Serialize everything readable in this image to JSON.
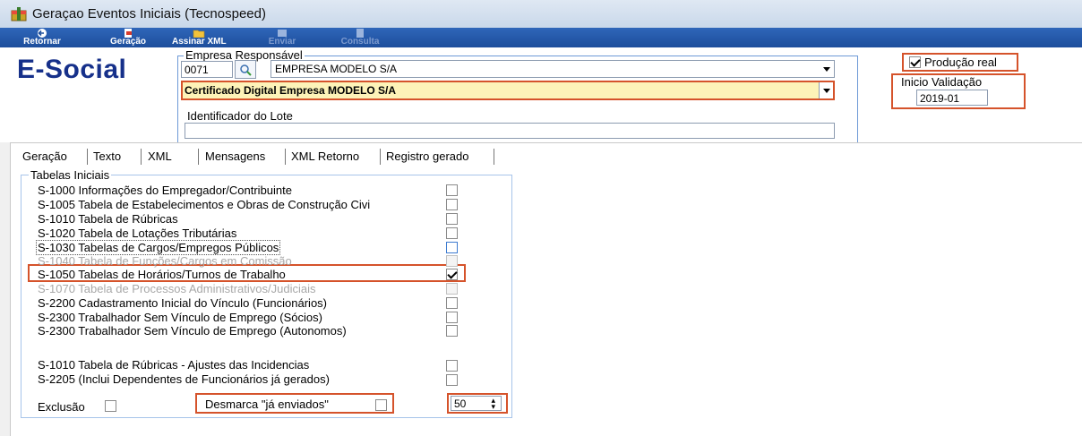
{
  "window": {
    "title": "Geraçao Eventos Iniciais (Tecnospeed)"
  },
  "toolbar": {
    "buttons": [
      {
        "label": "Retornar",
        "icon": "back-arrow-icon",
        "enabled": true
      },
      {
        "label": "Geração",
        "icon": "document-icon",
        "enabled": true
      },
      {
        "label": "Assinar XML",
        "icon": "folder-icon",
        "enabled": true
      },
      {
        "label": "Enviar",
        "icon": "send-icon",
        "enabled": false
      },
      {
        "label": "Consulta",
        "icon": "search-doc-icon",
        "enabled": false
      }
    ]
  },
  "brand": "E-Social",
  "empresa": {
    "legend": "Empresa Responsável",
    "code": "0071",
    "name": "EMPRESA MODELO S/A",
    "certificado": "Certificado Digital Empresa MODELO S/A",
    "lote_label": "Identificador do Lote",
    "lote_value": ""
  },
  "producao": {
    "label": "Produção real",
    "checked": true
  },
  "validacao": {
    "label": "Inicio Validação",
    "value": "2019-01"
  },
  "tabs": [
    "Geração",
    "Texto",
    "XML",
    "Mensagens",
    "XML Retorno",
    "Registro gerado"
  ],
  "tabelas": {
    "legend": "Tabelas Iniciais",
    "rows": [
      {
        "label": "S-1000 Informações do Empregador/Contribuinte",
        "checked": false,
        "disabled": false
      },
      {
        "label": "S-1005 Tabela de Estabelecimentos e Obras de Construção Civi",
        "checked": false,
        "disabled": false
      },
      {
        "label": "S-1010 Tabela de Rúbricas",
        "checked": false,
        "disabled": false
      },
      {
        "label": "S-1020 Tabela de Lotações Tributárias",
        "checked": false,
        "disabled": false
      },
      {
        "label": "S-1030 Tabelas de Cargos/Empregos Públicos",
        "checked": false,
        "disabled": false
      },
      {
        "label": "S-1040 Tabela de Funções/Cargos em Comissão",
        "checked": false,
        "disabled": true
      },
      {
        "label": "S-1050 Tabelas de Horários/Turnos de Trabalho",
        "checked": true,
        "disabled": false
      },
      {
        "label": "S-1070 Tabela de Processos Administrativos/Judiciais",
        "checked": false,
        "disabled": true
      },
      {
        "label": "S-2200 Cadastramento Inicial do Vínculo (Funcionários)",
        "checked": false,
        "disabled": false
      },
      {
        "label": "S-2300 Trabalhador Sem Vínculo de Emprego (Sócios)",
        "checked": false,
        "disabled": false
      },
      {
        "label": "S-2300 Trabalhador Sem Vínculo de Emprego (Autonomos)",
        "checked": false,
        "disabled": false
      },
      {
        "label": "S-1010 Tabela de Rúbricas - Ajustes das Incidencias",
        "checked": false,
        "disabled": false
      },
      {
        "label": "S-2205 (Inclui Dependentes de Funcionários já gerados)",
        "checked": false,
        "disabled": false
      }
    ]
  },
  "exclusao": {
    "label": "Exclusão",
    "checked": false
  },
  "desmarca": {
    "label": "Desmarca \"já enviados\"",
    "checked": false
  },
  "spin_value": "50"
}
